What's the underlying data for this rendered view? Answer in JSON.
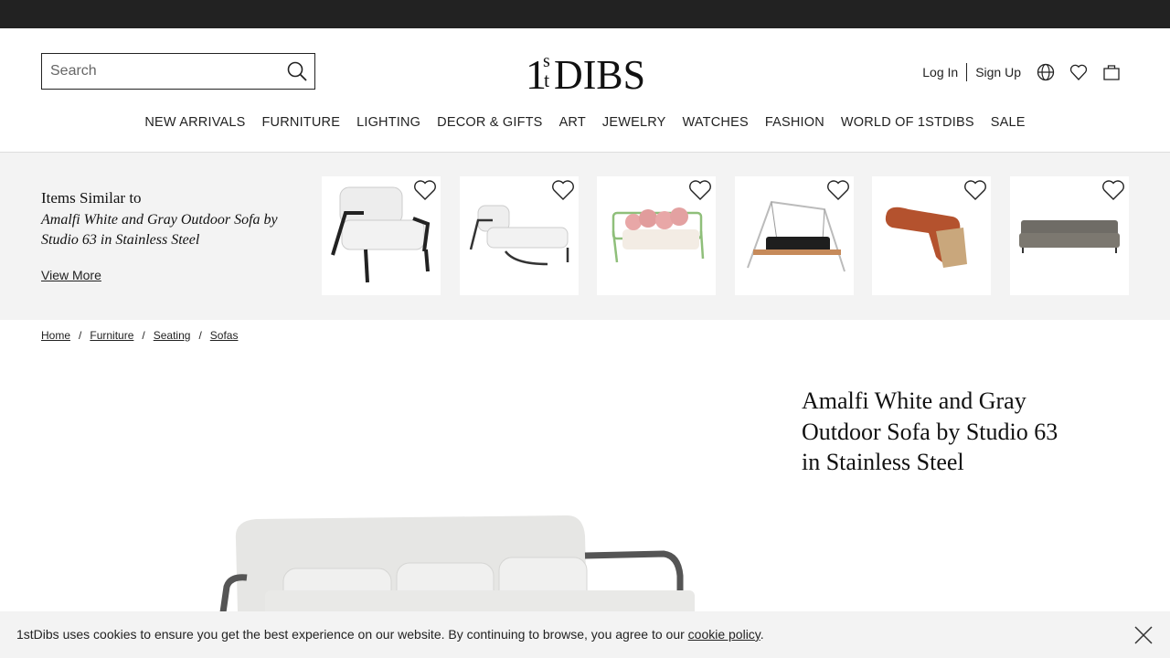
{
  "header": {
    "search_placeholder": "Search",
    "logo_text": "1stDIBS",
    "login": "Log In",
    "signup": "Sign Up"
  },
  "nav": [
    "NEW ARRIVALS",
    "FURNITURE",
    "LIGHTING",
    "DECOR & GIFTS",
    "ART",
    "JEWELRY",
    "WATCHES",
    "FASHION",
    "WORLD OF 1STDIBS",
    "SALE"
  ],
  "similar": {
    "heading": "Items Similar to",
    "item_name": "Amalfi White and Gray Outdoor Sofa by Studio 63 in Stainless Steel",
    "view_more": "View More",
    "tiles": [
      "white-lounge-chair",
      "white-chaise-lounge",
      "green-frame-sofa",
      "hanging-swing-bed",
      "orange-curved-sofa",
      "gray-long-sofa"
    ]
  },
  "breadcrumb": [
    "Home",
    "Furniture",
    "Seating",
    "Sofas"
  ],
  "product": {
    "title": "Amalfi White and Gray Outdoor Sofa by Studio 63 in Stainless Steel"
  },
  "cookie": {
    "text": "1stDibs uses cookies to ensure you get the best experience on our website. By continuing to browse, you agree to our ",
    "link": "cookie policy",
    "end": "."
  }
}
